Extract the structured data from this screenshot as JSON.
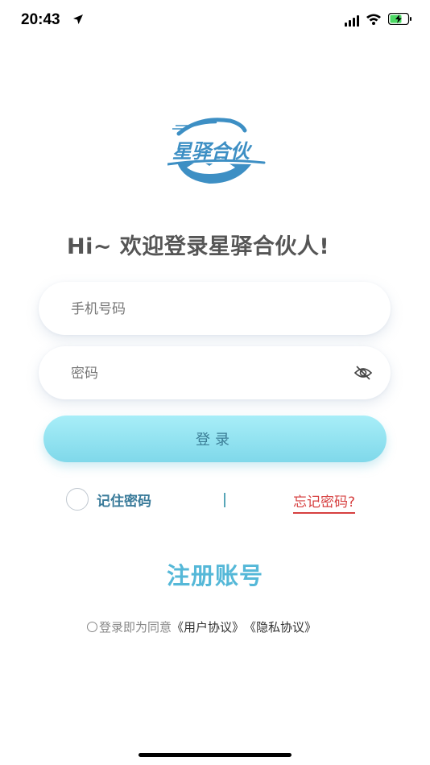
{
  "status_bar": {
    "time": "20:43"
  },
  "logo": {
    "text": "星驿合伙"
  },
  "greeting": "Hi~ 欢迎登录星驿合伙人!",
  "phone_field": {
    "placeholder": "手机号码",
    "value": ""
  },
  "password_field": {
    "placeholder": "密码",
    "value": ""
  },
  "login_button": "登录",
  "remember_label": "记住密码",
  "forgot_link": "忘记密码?",
  "register_link": "注册账号",
  "agreement": {
    "prefix": "登录即为同意",
    "user_agreement": "《用户协议》",
    "privacy_agreement": "《隐私协议》"
  },
  "colors": {
    "brand": "#55b8d8",
    "login_button": "#8fe2f0",
    "forgot": "#d64040",
    "remember": "#3a7b9a"
  }
}
